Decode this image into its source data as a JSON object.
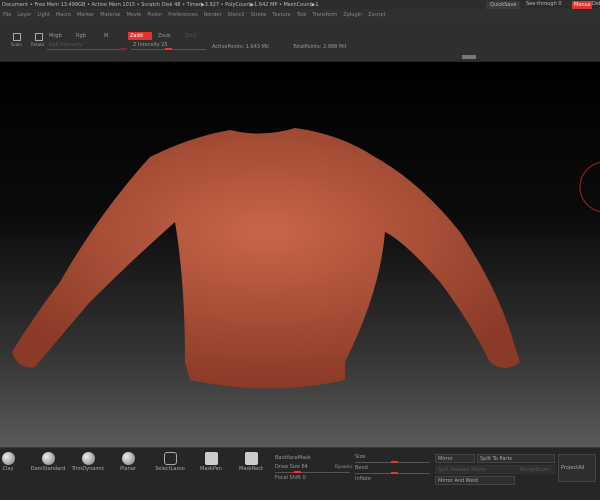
{
  "status": {
    "document": "Document",
    "info": "• Free Mem 13.499GB • Active Mem 1015 • Scratch Disk 48 • Timer▶3.927 • PolyCount▶1.642 MP • MeshCount▶1",
    "quicksave": "QuickSave",
    "seethrough": "See-through 0",
    "menus": "Menus",
    "default": "DefaultZScript"
  },
  "menu": [
    "File",
    "Layer",
    "Light",
    "Macro",
    "Marker",
    "Material",
    "Movie",
    "Picker",
    "Preferences",
    "Render",
    "Stencil",
    "Stroke",
    "Texture",
    "Tool",
    "Transform",
    "Zplugin",
    "Zscript"
  ],
  "shelf": {
    "scale": "Scale",
    "rotate": "Rotate",
    "mrgb": "Mrgb",
    "rgb": "Rgb",
    "m": "M",
    "zadd": "Zadd",
    "zsub": "Zsub",
    "zcut": "Zcut",
    "rgb_intensity": "Rgb Intensity",
    "z_intensity": "Z Intensity 25",
    "active_points": "ActivePoints: 1.643 Mil",
    "total_points": "TotalPoints: 2.988 Mil"
  },
  "brushes": [
    "Clay",
    "DamStandard",
    "TrimDynamic",
    "Planar",
    "SelectLasso",
    "MaskPen",
    "MaskRect"
  ],
  "stroke": {
    "backface": "BackfaceMask",
    "draw_size": "Draw Size 64",
    "dynamic": "Dynamic",
    "focal": "Focal Shift 0",
    "size": "Size",
    "bend": "Bend",
    "inflate": "Inflate"
  },
  "subtool": {
    "mirror": "Mirror",
    "split": "Split To Parts",
    "split_masked": "Split Masked Points",
    "merge_down": "MergeDown",
    "mirror_weld": "Mirror And Weld",
    "project_all": "ProjectAll"
  },
  "colors": {
    "accent": "#e0342c",
    "sweater": "#b0553c"
  }
}
